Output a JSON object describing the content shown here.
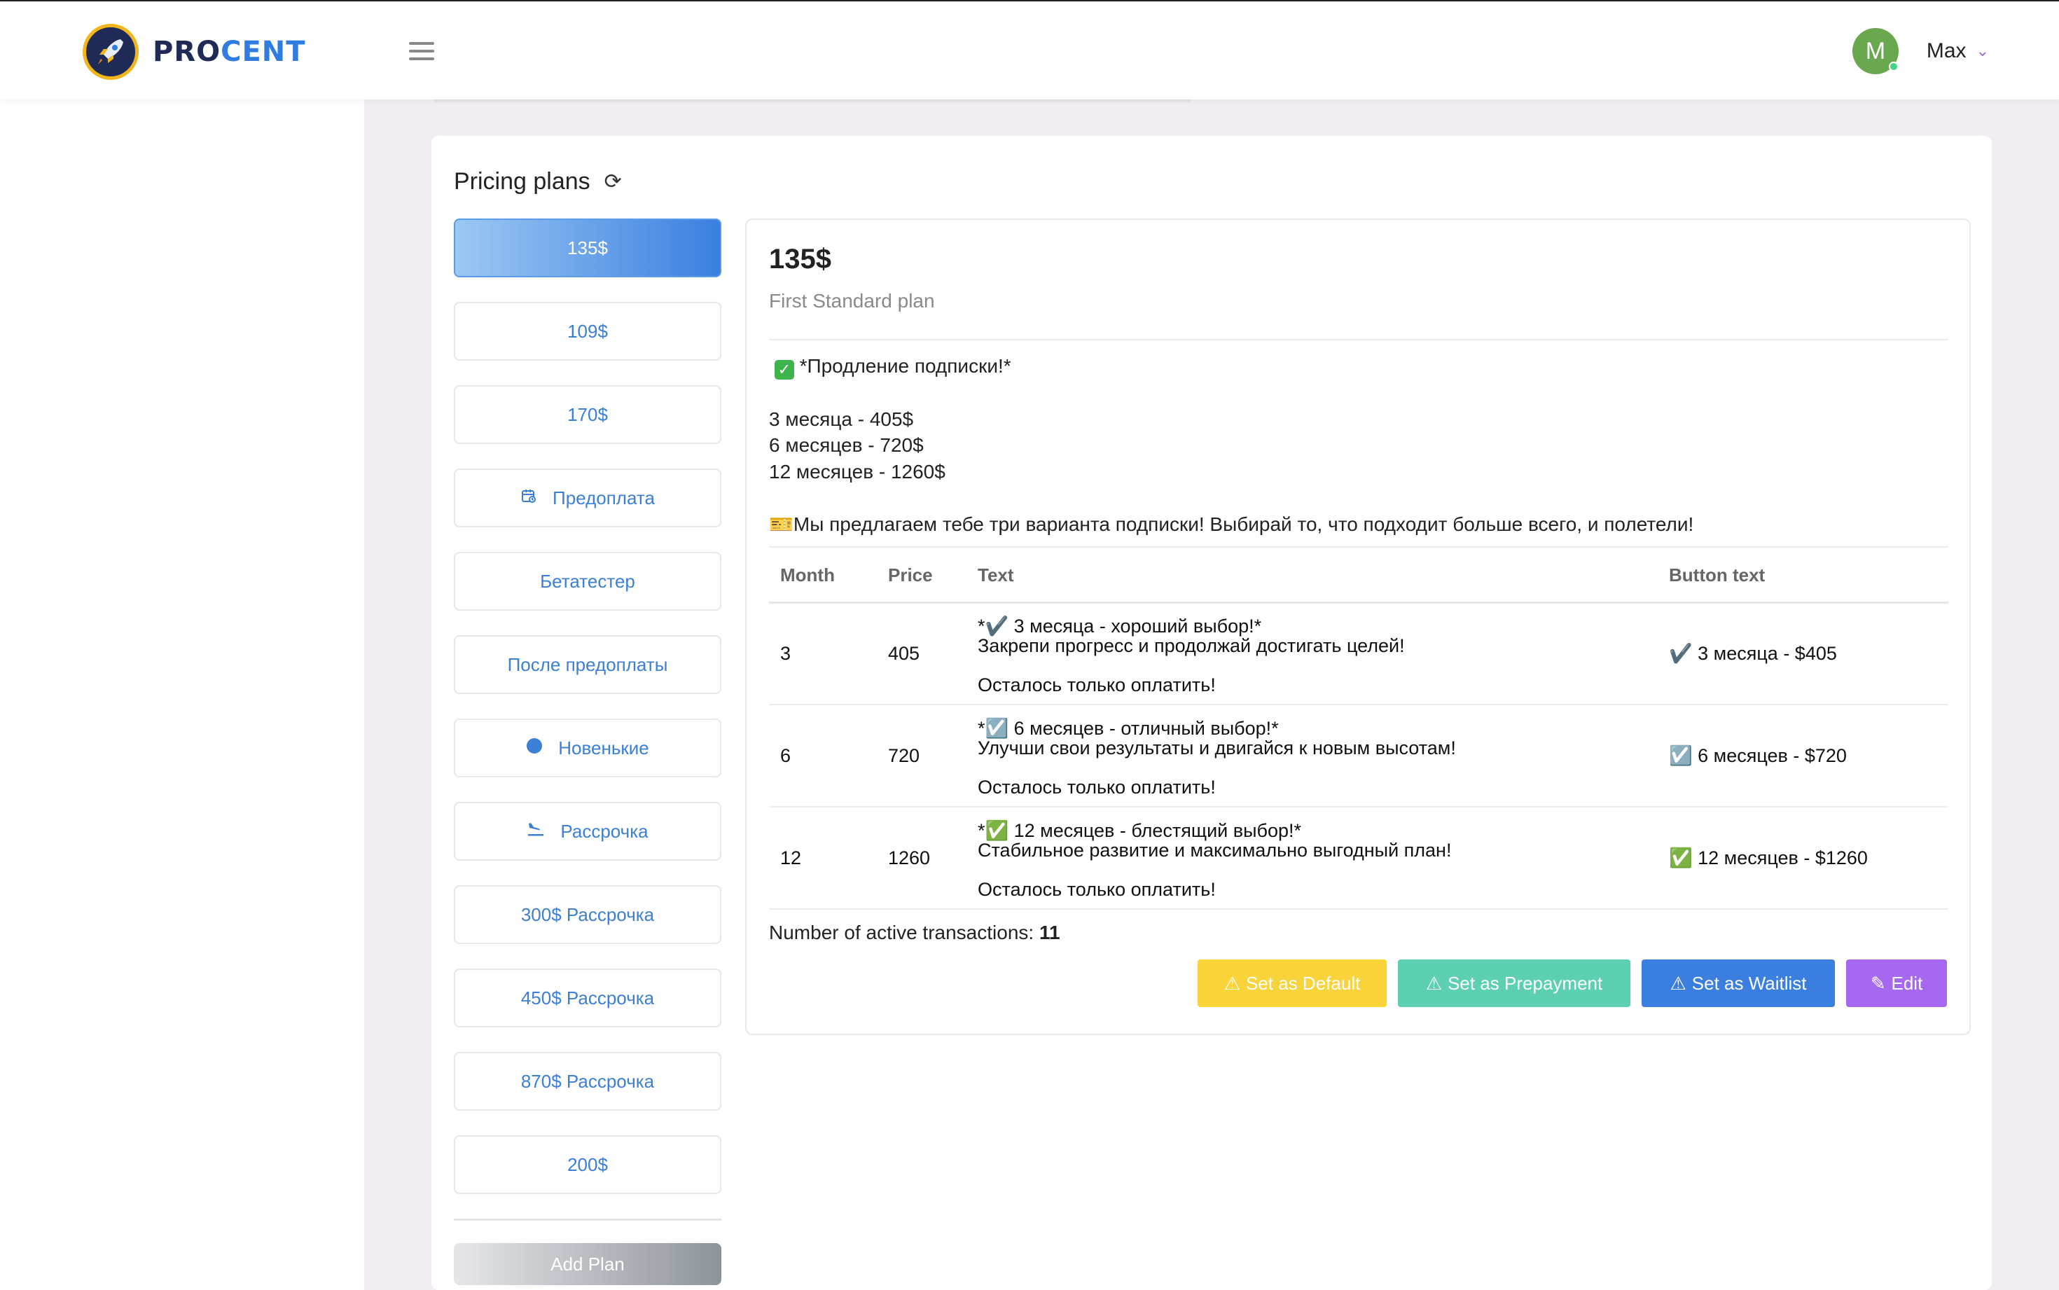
{
  "brand": {
    "part1": "PRO",
    "part2": "CENT"
  },
  "user": {
    "initial": "M",
    "name": "Max"
  },
  "card": {
    "title": "Pricing plans"
  },
  "plans": [
    {
      "label": "135$",
      "active": true
    },
    {
      "label": "109$"
    },
    {
      "label": "170$"
    },
    {
      "label": "Предоплата",
      "icon": "calendar-icon"
    },
    {
      "label": "Бетатестер"
    },
    {
      "label": "После предоплаты"
    },
    {
      "label": "Новенькие",
      "icon": "dot-icon"
    },
    {
      "label": "Рассрочка",
      "icon": "airplane-landing-icon"
    },
    {
      "label": "300$ Рассрочка"
    },
    {
      "label": "450$ Рассрочка"
    },
    {
      "label": "870$ Рассрочка"
    },
    {
      "label": "200$"
    }
  ],
  "add_plan_label": "Add Plan",
  "detail": {
    "price": "135$",
    "subtitle": "First Standard plan",
    "description": {
      "heading": "*Продление подписки!*",
      "line1": "3 месяца - 405$",
      "line2": "6 месяцев - 720$",
      "line3": "12 месяцев - 1260$",
      "tagline": "Мы предлагаем тебе три варианта подписки! Выбирай то, что подходит больше всего, и полетели!"
    },
    "table": {
      "headers": [
        "Month",
        "Price",
        "Text",
        "Button text"
      ],
      "rows": [
        {
          "month": "3",
          "price": "405",
          "text_line1": "*✔️ 3 месяца - хороший выбор!*",
          "text_line2": "Закрепи прогресс и продолжай достигать целей!",
          "text_line3": "Осталось только оплатить!",
          "button_text": "✔️ 3 месяца - $405"
        },
        {
          "month": "6",
          "price": "720",
          "text_line1": "*☑️ 6 месяцев - отличный выбор!*",
          "text_line2": "Улучши свои результаты и двигайся к новым высотам!",
          "text_line3": "Осталось только оплатить!",
          "button_text": "☑️ 6 месяцев - $720"
        },
        {
          "month": "12",
          "price": "1260",
          "text_line1": "*✅ 12 месяцев - блестящий выбор!*",
          "text_line2": "Стабильное развитие и максимально выгодный план!",
          "text_line3": "Осталось только оплатить!",
          "button_text": "✅ 12 месяцев - $1260"
        }
      ]
    },
    "active_transactions_label": "Number of active transactions:",
    "active_transactions_count": "11",
    "actions": {
      "set_default": "Set as Default",
      "set_prepayment": "Set as Prepayment",
      "set_waitlist": "Set as Waitlist",
      "edit": "Edit"
    }
  }
}
